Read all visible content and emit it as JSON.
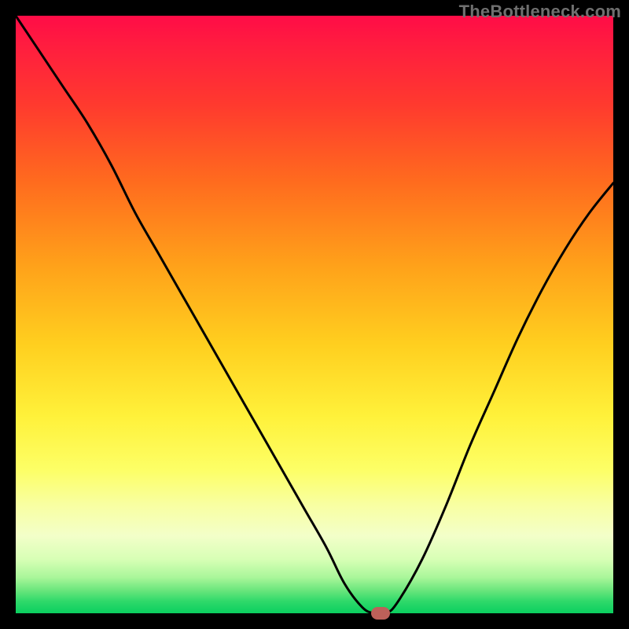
{
  "watermark": "TheBottleneck.com",
  "chart_data": {
    "type": "line",
    "title": "",
    "xlabel": "",
    "ylabel": "",
    "xlim": [
      0,
      100
    ],
    "ylim": [
      0,
      100
    ],
    "background_gradient": {
      "direction": "vertical",
      "stops": [
        {
          "pos": 0,
          "color": "#ff0c47"
        },
        {
          "pos": 15,
          "color": "#ff3a2e"
        },
        {
          "pos": 28,
          "color": "#ff6c1e"
        },
        {
          "pos": 42,
          "color": "#ffa21a"
        },
        {
          "pos": 55,
          "color": "#ffcf1f"
        },
        {
          "pos": 67,
          "color": "#fff13a"
        },
        {
          "pos": 82,
          "color": "#f8ffa3"
        },
        {
          "pos": 94,
          "color": "#a9f69a"
        },
        {
          "pos": 100,
          "color": "#0acf5f"
        }
      ]
    },
    "series": [
      {
        "name": "bottleneck-curve",
        "color": "#000000",
        "x": [
          0,
          4,
          8,
          12,
          16,
          20,
          24,
          28,
          32,
          36,
          40,
          44,
          48,
          52,
          55,
          58,
          60,
          62,
          64,
          68,
          72,
          76,
          80,
          84,
          88,
          92,
          96,
          100
        ],
        "values": [
          100,
          94,
          88,
          82,
          75,
          67,
          60,
          53,
          46,
          39,
          32,
          25,
          18,
          11,
          5,
          1,
          0,
          0,
          2,
          9,
          18,
          28,
          37,
          46,
          54,
          61,
          67,
          72
        ]
      }
    ],
    "marker": {
      "x": 61,
      "y": 0,
      "color": "#bd6059"
    }
  }
}
